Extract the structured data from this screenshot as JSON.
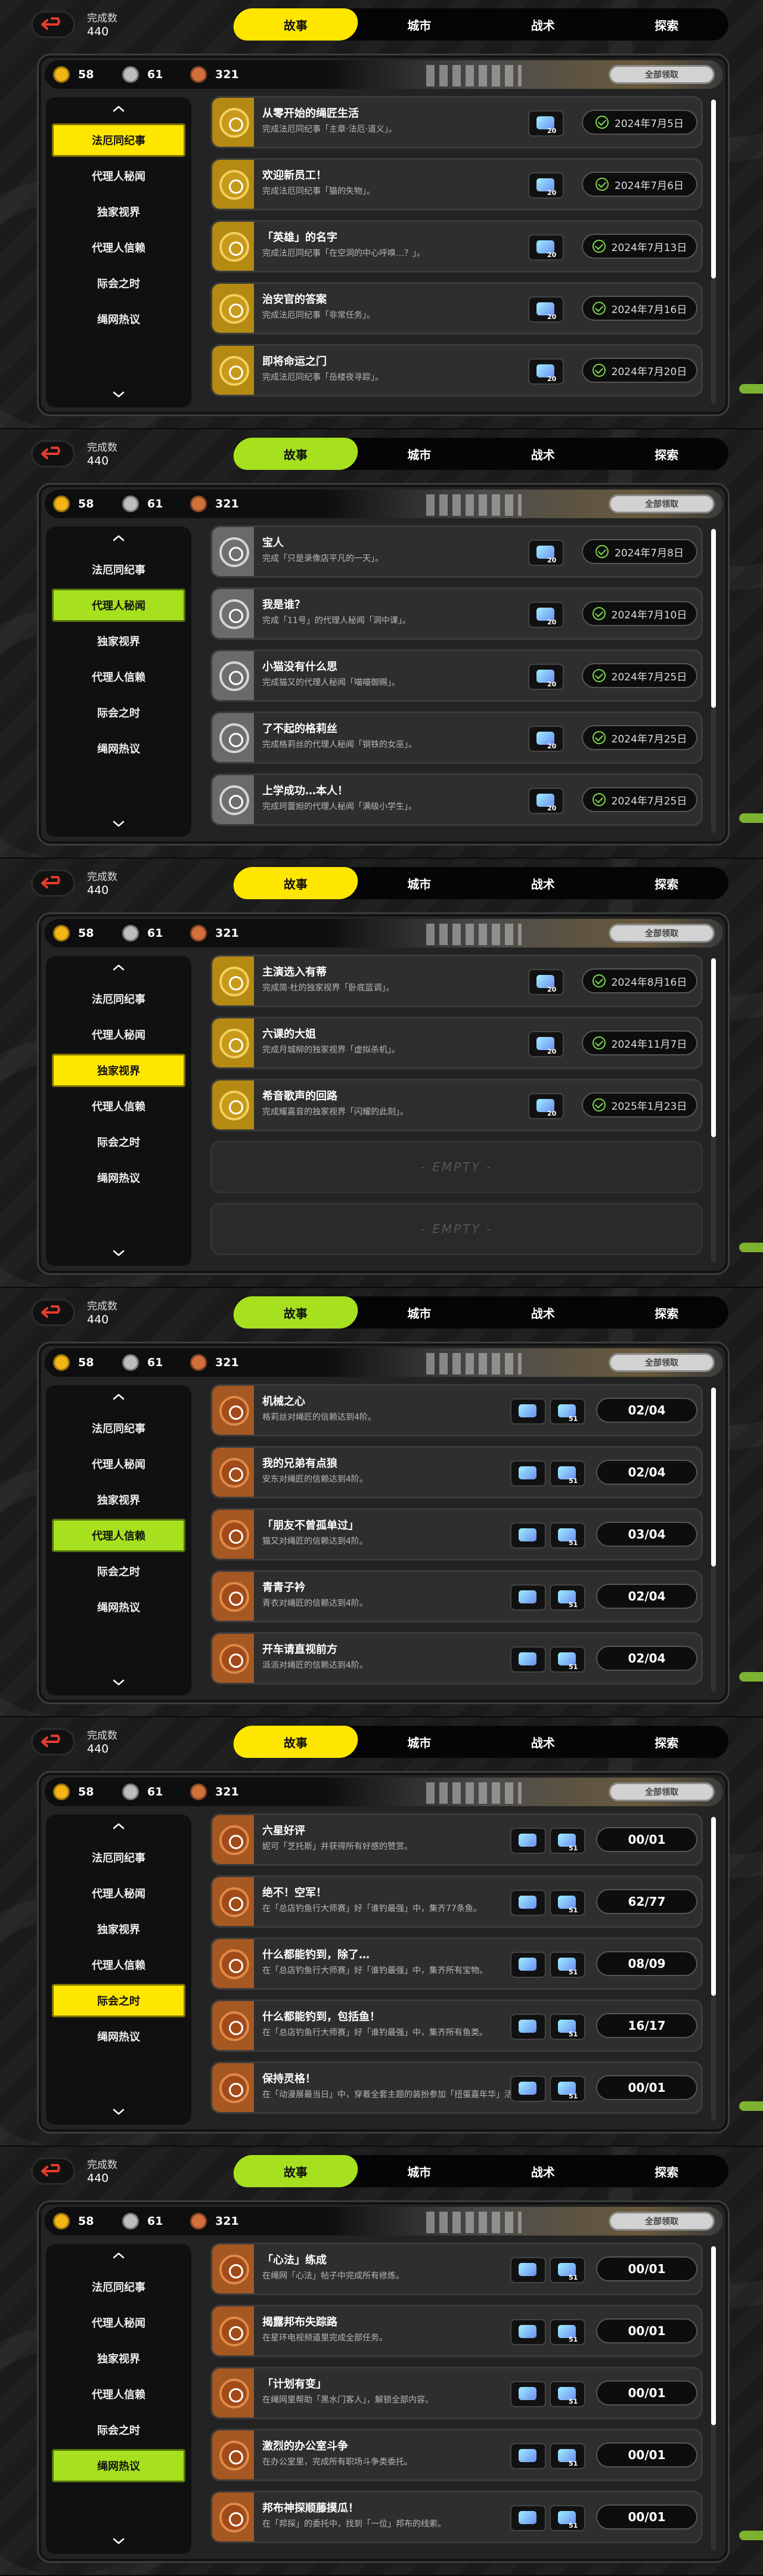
{
  "common": {
    "completion_label": "完成数",
    "completion_value": "440",
    "tabs": [
      "故事",
      "城市",
      "战术",
      "探索"
    ],
    "currencies": [
      "58",
      "61",
      "321"
    ],
    "claim_all": "全部领取",
    "sidebar": [
      "法厄同纪事",
      "代理人秘闻",
      "独家视界",
      "代理人信赖",
      "际会之时",
      "绳网热议"
    ],
    "empty_label": "- EMPTY -"
  },
  "colors": {
    "yellow": "#ffe600",
    "green": "#a6e01f"
  },
  "icons": [
    "back-arrow-icon",
    "coin-gold-icon",
    "coin-silver-icon",
    "coin-bronze-icon",
    "chevron-up-icon",
    "chevron-down-icon",
    "check-circle-icon",
    "polychrome-reward-icon"
  ],
  "screens": [
    {
      "selected": 0,
      "accent": "yellow",
      "cards": [
        {
          "title": "从零开始的绳匠生活",
          "desc": "完成法厄同纪事「主章·法厄·道义」。",
          "reward": "20",
          "status": "2024年7月5日"
        },
        {
          "title": "欢迎新员工！",
          "desc": "完成法厄同纪事「猫的失物」。",
          "reward": "20",
          "status": "2024年7月6日"
        },
        {
          "title": "「英雄」的名字",
          "desc": "完成法厄同纪事「在空洞的中心呼唤…？」。",
          "reward": "20",
          "status": "2024年7月13日"
        },
        {
          "title": "治安官的答案",
          "desc": "完成法厄同纪事「非常任务」。",
          "reward": "20",
          "status": "2024年7月16日"
        },
        {
          "title": "即将命运之门",
          "desc": "完成法厄同纪事「岳楼夜寻踪」。",
          "reward": "20",
          "status": "2024年7月20日"
        }
      ]
    },
    {
      "selected": 1,
      "accent": "green",
      "cards": [
        {
          "title": "宝人",
          "desc": "完成「只是录像店平凡的一天」。",
          "reward": "20",
          "status": "2024年7月8日"
        },
        {
          "title": "我是谁？",
          "desc": "完成「11号」的代理人秘闻「洞中课」。",
          "reward": "20",
          "status": "2024年7月10日"
        },
        {
          "title": "小猫没有什么思",
          "desc": "完成猫又的代理人秘闻「喵喵御赐」。",
          "reward": "20",
          "status": "2024年7月25日"
        },
        {
          "title": "了不起的格莉丝",
          "desc": "完成格莉丝的代理人秘闻「钢铁的女巫」。",
          "reward": "20",
          "status": "2024年7月25日"
        },
        {
          "title": "上学成功…本人！",
          "desc": "完成珂蕾妲的代理人秘闻「满级小学生」。",
          "reward": "20",
          "status": "2024年7月25日"
        }
      ]
    },
    {
      "selected": 2,
      "accent": "yellow",
      "cards": [
        {
          "title": "主演选入有蒂",
          "desc": "完成简·杜的独家视界「卧底蓝调」。",
          "reward": "20",
          "status": "2024年8月16日"
        },
        {
          "title": "六课的大姐",
          "desc": "完成月城柳的独家视界「虚拟杀机」。",
          "reward": "20",
          "status": "2024年11月7日"
        },
        {
          "title": "希音歌声的回路",
          "desc": "完成耀嘉音的独家视界「闪耀的此刻」。",
          "reward": "20",
          "status": "2025年1月23日"
        }
      ],
      "empty_slots": 2
    },
    {
      "selected": 3,
      "accent": "green",
      "cards": [
        {
          "title": "机械之心",
          "desc": "格莉丝对绳匠的信赖达到4阶。",
          "reward": "51",
          "status": "02/04"
        },
        {
          "title": "我的兄弟有点狼",
          "desc": "安东对绳匠的信赖达到4阶。",
          "reward": "51",
          "status": "02/04"
        },
        {
          "title": "「朋友不曾孤单过」",
          "desc": "猫又对绳匠的信赖达到4阶。",
          "reward": "51",
          "status": "03/04"
        },
        {
          "title": "青青子衿",
          "desc": "青衣对绳匠的信赖达到4阶。",
          "reward": "51",
          "status": "02/04"
        },
        {
          "title": "开车请直视前方",
          "desc": "派派对绳匠的信赖达到4阶。",
          "reward": "51",
          "status": "02/04"
        }
      ]
    },
    {
      "selected": 4,
      "accent": "yellow",
      "cards": [
        {
          "title": "六星好评",
          "desc": "妮可「芝托斯」并获得所有好感的赞赏。",
          "reward": "51",
          "status": "00/01"
        },
        {
          "title": "绝不！空军！",
          "desc": "在「总店钓鱼行大师赛」好「谁钓最强」中，集齐77条鱼。",
          "reward": "51",
          "status": "62/77"
        },
        {
          "title": "什么都能钓到，除了…",
          "desc": "在「总店钓鱼行大师赛」好「谁钓最强」中，集齐所有宝物。",
          "reward": "51",
          "status": "08/09"
        },
        {
          "title": "什么都能钓到，包括鱼！",
          "desc": "在「总店钓鱼行大师赛」好「谁钓最强」中，集齐所有鱼类。",
          "reward": "51",
          "status": "16/17"
        },
        {
          "title": "保持灵格！",
          "desc": "在「动漫展最当日」中，穿着全套主题的装扮参加「扭蛋嘉年华」活动。",
          "reward": "51",
          "status": "00/01"
        }
      ]
    },
    {
      "selected": 5,
      "accent": "green",
      "cards": [
        {
          "title": "「心法」练成",
          "desc": "在绳网「心法」帖子中完成所有修炼。",
          "reward": "51",
          "status": "00/01"
        },
        {
          "title": "揭露邦布失踪路",
          "desc": "在星环电视频道里完成全部任务。",
          "reward": "51",
          "status": "00/01"
        },
        {
          "title": "「计划有变」",
          "desc": "在绳网里帮助「黑水门客人」，解锁全部内容。",
          "reward": "51",
          "status": "00/01"
        },
        {
          "title": "激烈的办公室斗争",
          "desc": "在办公室里，完成所有职场斗争类委托。",
          "reward": "51",
          "status": "00/01"
        },
        {
          "title": "邦布神探顺藤摸瓜！",
          "desc": "在「邦探」的委托中，找到「一位」邦布的线索。",
          "reward": "51",
          "status": "00/01"
        }
      ]
    }
  ]
}
